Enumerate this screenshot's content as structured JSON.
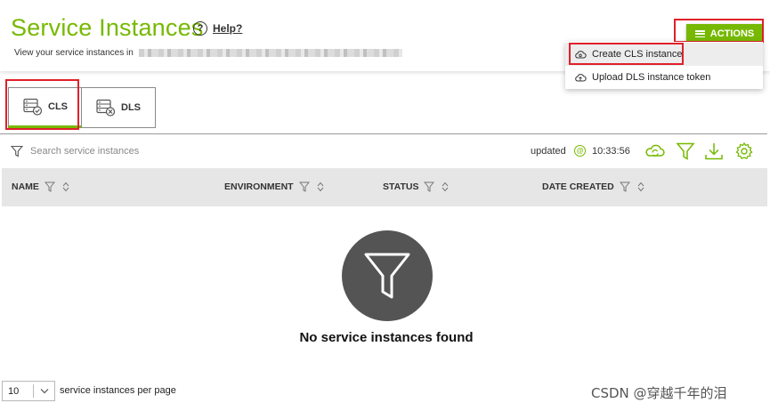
{
  "header": {
    "title": "Service Instances",
    "help_label": "Help?",
    "subtitle": "View your service instances in"
  },
  "actions": {
    "label": "ACTIONS",
    "menu": [
      {
        "label": "Create CLS instance",
        "icon": "cloud-gear-icon"
      },
      {
        "label": "Upload DLS instance token",
        "icon": "cloud-upload-icon"
      }
    ]
  },
  "tabs": [
    {
      "label": "CLS",
      "icon": "server-check-icon",
      "selected": true
    },
    {
      "label": "DLS",
      "icon": "server-x-icon",
      "selected": false
    }
  ],
  "toolbar": {
    "search_placeholder": "Search service instances",
    "updated_label": "updated",
    "time": "10:33:56"
  },
  "table": {
    "columns": [
      "NAME",
      "ENVIRONMENT",
      "STATUS",
      "DATE CREATED"
    ]
  },
  "empty_state": {
    "message": "No service instances found"
  },
  "pagination": {
    "per_page_value": "10",
    "per_page_label": "service instances per page"
  },
  "watermark": "CSDN @穿越千年的泪",
  "colors": {
    "accent": "#76b900",
    "highlight": "#e0202a",
    "header_row": "#e6e6e6",
    "empty_circle": "#545454"
  }
}
